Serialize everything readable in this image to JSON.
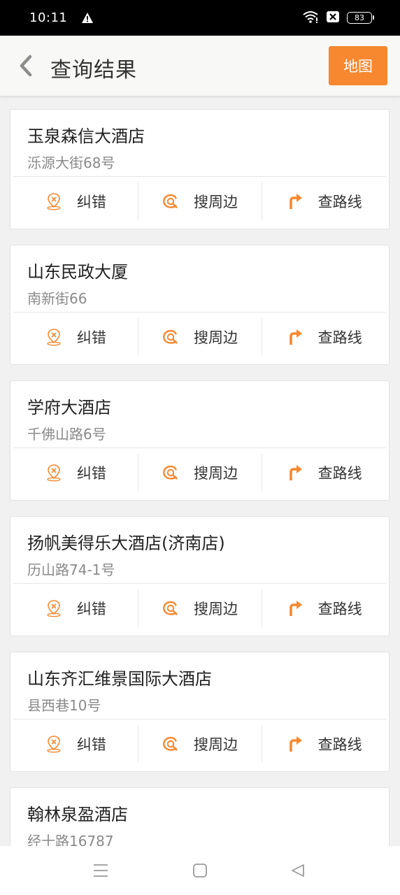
{
  "status_bar": {
    "time": "10:11",
    "battery": "83",
    "icons": [
      "warning-icon",
      "wifi-icon",
      "x-box-icon",
      "battery-icon"
    ]
  },
  "header": {
    "title": "查询结果",
    "map_button": "地图",
    "back_icon": "chevron-left-icon"
  },
  "actions": {
    "correct": "纠错",
    "nearby": "搜周边",
    "route": "查路线"
  },
  "colors": {
    "accent": "#f7882f",
    "background": "#f1f1f1",
    "card": "#ffffff",
    "secondary_text": "#8a8a8a"
  },
  "results": [
    {
      "name": "玉泉森信大酒店",
      "address": "泺源大街68号"
    },
    {
      "name": "山东民政大厦",
      "address": "南新街66"
    },
    {
      "name": "学府大酒店",
      "address": "千佛山路6号"
    },
    {
      "name": "扬帆美得乐大酒店(济南店)",
      "address": "历山路74-1号"
    },
    {
      "name": "山东齐汇维景国际大酒店",
      "address": "县西巷10号"
    },
    {
      "name": "翰林泉盈酒店",
      "address": "经十路16787"
    }
  ],
  "nav_bar": {
    "icons": [
      "menu-icon",
      "home-square-icon",
      "back-triangle-icon"
    ]
  }
}
